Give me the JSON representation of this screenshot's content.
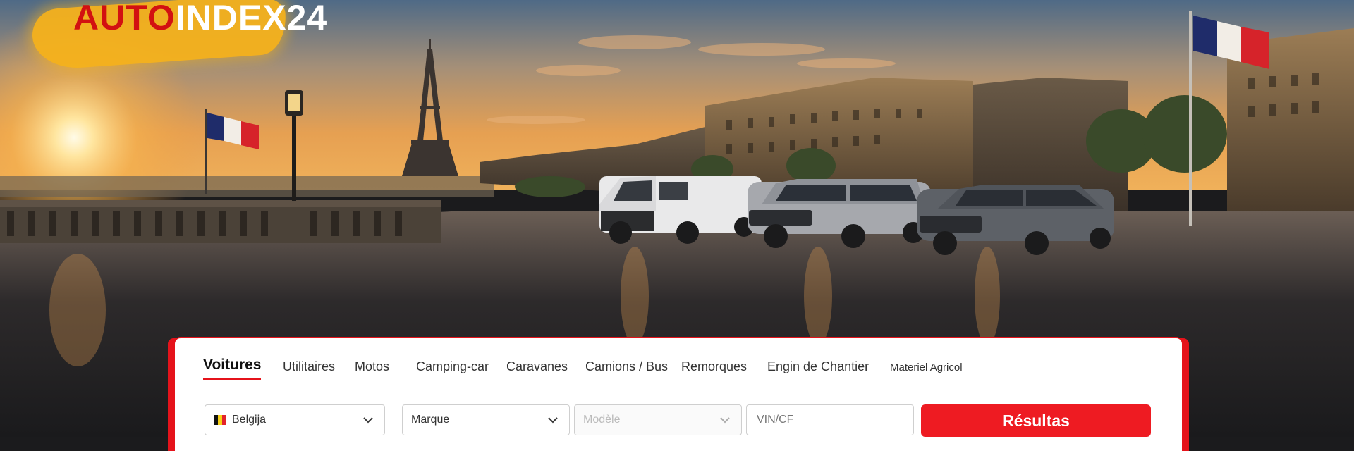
{
  "logo": {
    "part1": "AUTO",
    "part2": "INDEX24"
  },
  "tabs": [
    {
      "label": "Voitures",
      "active": true
    },
    {
      "label": "Utilitaires"
    },
    {
      "label": "Motos"
    },
    {
      "label": "Camping-car"
    },
    {
      "label": "Caravanes"
    },
    {
      "label": "Camions / Bus"
    },
    {
      "label": "Remorques"
    },
    {
      "label": "Engin de Chantier"
    },
    {
      "label": "Materiel Agricol"
    }
  ],
  "search": {
    "country_value": "Belgija",
    "brand_value": "Marque",
    "model_placeholder": "Modèle",
    "vin_placeholder": "VIN/CF",
    "results_label": "Résultas"
  },
  "colors": {
    "accent": "#ee1b22",
    "logo_red": "#d21111",
    "logo_brush": "#f6b21c"
  },
  "icons": [
    "chevron-down-icon",
    "belgium-flag-icon",
    "france-flag-icon"
  ]
}
